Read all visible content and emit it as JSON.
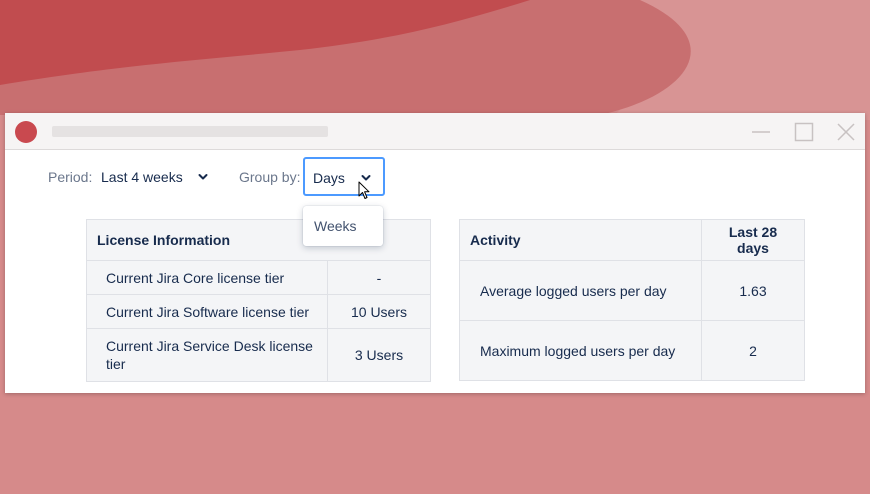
{
  "colors": {
    "background": "#d68a8a",
    "accent": "#c9494f",
    "focus_border": "#4c9aff"
  },
  "toolbar": {
    "period_label": "Period:",
    "period_value": "Last 4 weeks",
    "groupby_label": "Group by:",
    "groupby_value": "Days",
    "groupby_options": [
      "Weeks"
    ]
  },
  "license_table": {
    "header": "License Information",
    "rows": [
      {
        "label": "Current Jira Core license tier",
        "value": "-"
      },
      {
        "label": "Current Jira Software license tier",
        "value": "10 Users"
      },
      {
        "label": "Current Jira Service Desk license tier",
        "value": "3 Users"
      }
    ]
  },
  "activity_table": {
    "headers": [
      "Activity",
      "Last 28 days"
    ],
    "rows": [
      {
        "label": "Average logged users per day",
        "value": "1.63"
      },
      {
        "label": "Maximum logged users per day",
        "value": "2"
      }
    ]
  },
  "icons": {
    "window_controls": [
      "minimize-icon",
      "maximize-icon",
      "close-icon"
    ],
    "dropdown": "chevron-down-icon",
    "pointer": "cursor-icon"
  }
}
